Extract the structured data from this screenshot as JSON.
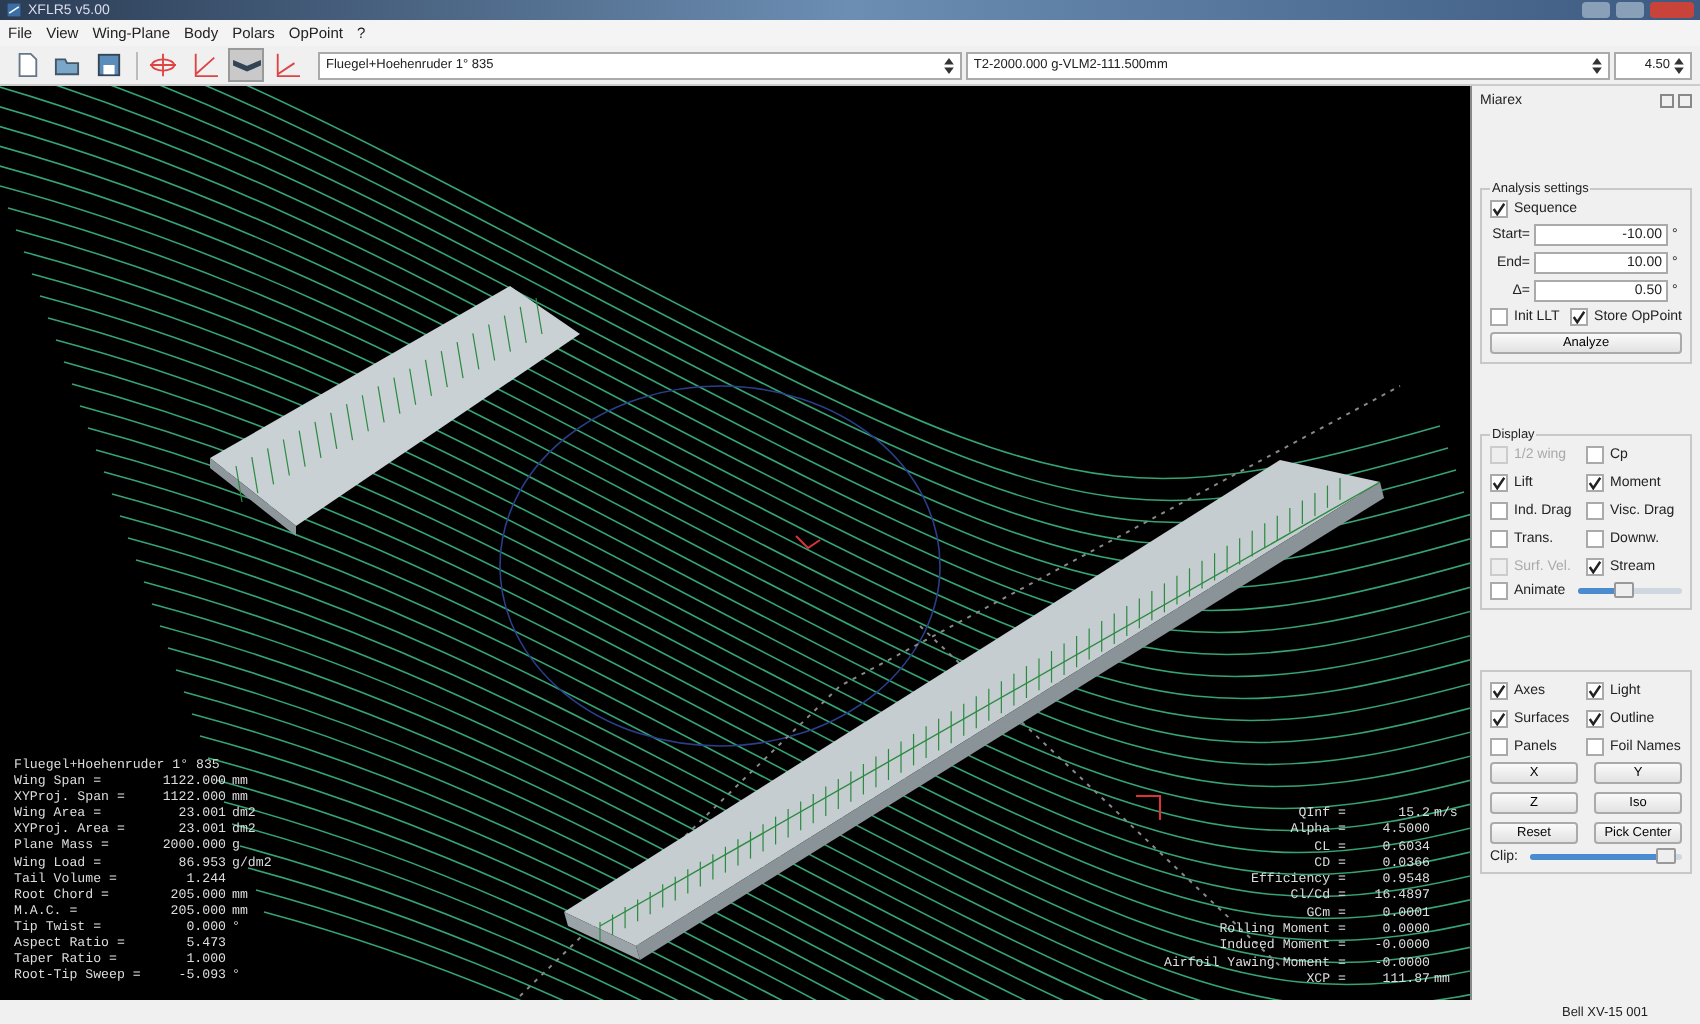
{
  "window": {
    "title": "XFLR5 v5.00"
  },
  "menu": [
    "File",
    "View",
    "Wing-Plane",
    "Body",
    "Polars",
    "OpPoint",
    "?"
  ],
  "toolbar": {
    "view_buttons": [
      {
        "selected": false
      },
      {
        "selected": false
      },
      {
        "selected": true
      },
      {
        "selected": false
      }
    ],
    "plane": "Fluegel+Hoehenruder 1° 835",
    "polar": "T2-2000.000 g-VLM2-111.500mm",
    "opp": "4.50"
  },
  "viewport": {
    "plane_name": "Fluegel+Hoehenruder 1° 835",
    "properties": [
      {
        "label": "Wing Span =",
        "value": "1122.000",
        "unit": "mm"
      },
      {
        "label": "XYProj. Span =",
        "value": "1122.000",
        "unit": "mm"
      },
      {
        "label": "Wing Area =",
        "value": "23.001",
        "unit": "dm2"
      },
      {
        "label": "XYProj. Area =",
        "value": "23.001",
        "unit": "dm2"
      },
      {
        "label": "Plane Mass =",
        "value": "2000.000",
        "unit": "g"
      },
      {
        "label": "Wing Load =",
        "value": "86.953",
        "unit": "g/dm2"
      },
      {
        "label": "Tail Volume =",
        "value": "1.244"
      },
      {
        "label": "Root Chord =",
        "value": "205.000",
        "unit": "mm"
      },
      {
        "label": "M.A.C. =",
        "value": "205.000",
        "unit": "mm"
      },
      {
        "label": "Tip Twist =",
        "value": "0.000",
        "unit": "°"
      },
      {
        "label": "Aspect Ratio =",
        "value": "5.473"
      },
      {
        "label": "Taper Ratio =",
        "value": "1.000"
      },
      {
        "label": "Root-Tip Sweep =",
        "value": "-5.093",
        "unit": "°"
      }
    ],
    "results": [
      {
        "label": "QInf =",
        "value": "15.2",
        "unit": "m/s"
      },
      {
        "label": "Alpha =",
        "value": "4.5000"
      },
      {
        "label": "CL =",
        "value": "0.6034"
      },
      {
        "label": "CD =",
        "value": "0.0366"
      },
      {
        "label": "Efficiency =",
        "value": "0.9548"
      },
      {
        "label": "Cl/Cd =",
        "value": "16.4897"
      },
      {
        "label": "GCm =",
        "value": "0.0001"
      },
      {
        "label": "Rolling Moment =",
        "value": "0.0000"
      },
      {
        "label": "Induced Moment =",
        "value": "-0.0000"
      },
      {
        "label": "Airfoil Yawing Moment =",
        "value": "-0.0000"
      },
      {
        "label": "XCP =",
        "value": "111.87",
        "unit": "mm"
      }
    ]
  },
  "panel": {
    "title": "Miarex",
    "analysis": {
      "title": "Analysis settings",
      "sequence": {
        "label": "Sequence",
        "checked": true
      },
      "fields": [
        {
          "label": "Start=",
          "value": "-10.00",
          "unit": "°"
        },
        {
          "label": "End=",
          "value": "10.00",
          "unit": "°"
        },
        {
          "label": "Δ=",
          "value": "0.50",
          "unit": "°"
        }
      ],
      "options": [
        {
          "label": "Init LLT",
          "checked": false
        },
        {
          "label": "Store OpPoint",
          "checked": true
        }
      ],
      "button": "Analyze"
    },
    "display": {
      "title": "Display",
      "options": [
        {
          "label": "1/2 wing",
          "checked": false,
          "disabled": true
        },
        {
          "label": "Cp",
          "checked": false,
          "disabled": false
        },
        {
          "label": "Lift",
          "checked": true,
          "disabled": false
        },
        {
          "label": "Moment",
          "checked": true,
          "disabled": false
        },
        {
          "label": "Ind. Drag",
          "checked": false,
          "disabled": false
        },
        {
          "label": "Visc. Drag",
          "checked": false,
          "disabled": false
        },
        {
          "label": "Trans.",
          "checked": false,
          "disabled": false
        },
        {
          "label": "Downw.",
          "checked": false,
          "disabled": false
        },
        {
          "label": "Surf. Vel.",
          "checked": false,
          "disabled": true
        },
        {
          "label": "Stream",
          "checked": true,
          "disabled": false
        }
      ],
      "animate": {
        "label": "Animate",
        "checked": false,
        "level": 0.45
      }
    },
    "view": {
      "options": [
        {
          "label": "Axes",
          "checked": true
        },
        {
          "label": "Light",
          "checked": true
        },
        {
          "label": "Surfaces",
          "checked": true
        },
        {
          "label": "Outline",
          "checked": true
        },
        {
          "label": "Panels",
          "checked": false
        },
        {
          "label": "Foil Names",
          "checked": false
        }
      ],
      "buttons": [
        "X",
        "Y",
        "Z",
        "Iso",
        "Reset",
        "Pick Center"
      ],
      "clip": {
        "label": "Clip:",
        "level": 0.96
      }
    }
  },
  "status_bar": {
    "text": "Bell XV-15 001"
  }
}
